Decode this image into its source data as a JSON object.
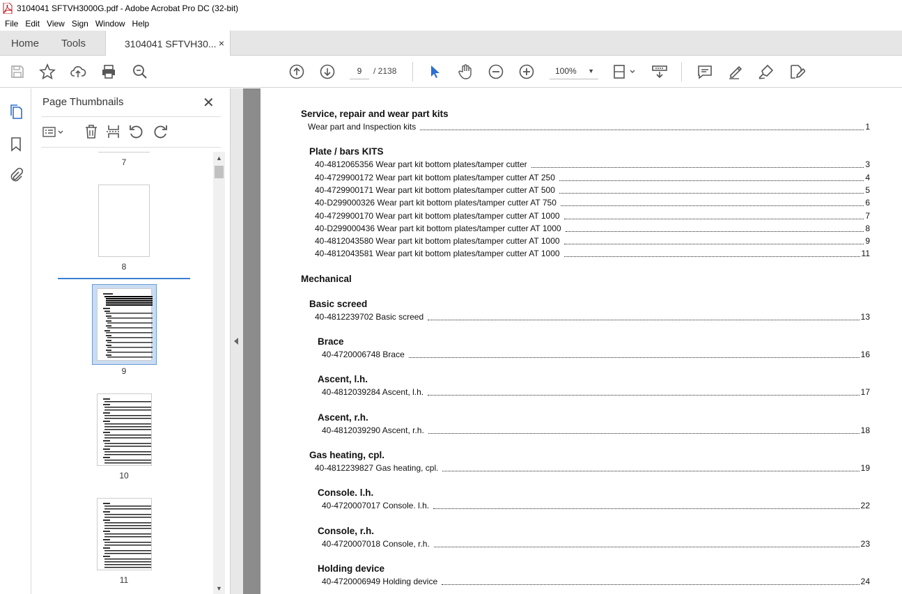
{
  "window": {
    "title": "3104041 SFTVH3000G.pdf - Adobe Acrobat Pro DC (32-bit)"
  },
  "menu": [
    "File",
    "Edit",
    "View",
    "Sign",
    "Window",
    "Help"
  ],
  "tabs": {
    "home": "Home",
    "tools": "Tools",
    "document": "3104041 SFTVH30...",
    "close_glyph": "×"
  },
  "toolbar": {
    "current_page": "9",
    "page_total": "/ 2138",
    "zoom": "100%",
    "zoom_caret": "▼",
    "icons": [
      "save-icon",
      "bookmark-star-icon",
      "upload-icon",
      "print-icon",
      "find-zoom-icon",
      "prev-page-icon",
      "next-page-icon",
      "select-cursor-icon",
      "hand-icon",
      "zoom-out-icon",
      "zoom-in-icon",
      "page-fit-icon",
      "scroll-mode-icon",
      "comment-icon",
      "highlight-icon",
      "sign-icon",
      "edit-pdf-icon"
    ]
  },
  "thumbnails_panel": {
    "title": "Page Thumbnails",
    "close_glyph": "✕",
    "pages": [
      {
        "label": "7"
      },
      {
        "label": "8"
      },
      {
        "label": "9"
      },
      {
        "label": "10"
      },
      {
        "label": "11"
      }
    ]
  },
  "colors": {
    "accent": "#3a7fd0",
    "selected_thumb_bg": "#c9dcf2",
    "doc_bg": "#8c8c8c"
  },
  "toc": {
    "sections": [
      {
        "heading": "Service, repair and wear part kits",
        "entries": [
          {
            "label": "Wear part and Inspection kits",
            "page": "1"
          }
        ]
      },
      {
        "heading": "Plate / bars KITS",
        "entries": [
          {
            "label": "40-4812065356 Wear part kit bottom plates/tamper cutter",
            "page": "3"
          },
          {
            "label": "40-4729900172 Wear part kit bottom plates/tamper cutter AT 250",
            "page": "4"
          },
          {
            "label": "40-4729900171 Wear part kit bottom plates/tamper cutter AT 500",
            "page": "5"
          },
          {
            "label": "40-D299000326 Wear part kit bottom plates/tamper cutter AT 750",
            "page": "6"
          },
          {
            "label": "40-4729900170 Wear part kit bottom plates/tamper cutter AT 1000",
            "page": "7"
          },
          {
            "label": "40-D299000436 Wear part kit bottom plates/tamper cutter AT 1000",
            "page": "8"
          },
          {
            "label": "40-4812043580 Wear part kit bottom plates/tamper cutter AT 1000",
            "page": "9"
          },
          {
            "label": "40-4812043581 Wear part kit bottom plates/tamper cutter AT 1000",
            "page": "11"
          }
        ]
      },
      {
        "heading": "Mechanical",
        "entries": []
      },
      {
        "heading": "Basic screed",
        "entries": [
          {
            "label": "40-4812239702 Basic screed",
            "page": "13"
          }
        ]
      },
      {
        "heading": "Brace",
        "entries": [
          {
            "label": "40-4720006748 Brace",
            "page": "16"
          }
        ]
      },
      {
        "heading": "Ascent, l.h.",
        "entries": [
          {
            "label": "40-4812039284 Ascent, l.h.",
            "page": "17"
          }
        ]
      },
      {
        "heading": "Ascent, r.h.",
        "entries": [
          {
            "label": "40-4812039290 Ascent, r.h.",
            "page": "18"
          }
        ]
      },
      {
        "heading": "Gas heating, cpl.",
        "entries": [
          {
            "label": "40-4812239827 Gas heating, cpl.",
            "page": "19"
          }
        ]
      },
      {
        "heading": "Console. l.h.",
        "entries": [
          {
            "label": "40-4720007017 Console. l.h.",
            "page": "22"
          }
        ]
      },
      {
        "heading": "Console, r.h.",
        "entries": [
          {
            "label": "40-4720007018 Console, r.h.",
            "page": "23"
          }
        ]
      },
      {
        "heading": "Holding device",
        "entries": [
          {
            "label": "40-4720006949 Holding device",
            "page": "24"
          }
        ]
      }
    ]
  }
}
